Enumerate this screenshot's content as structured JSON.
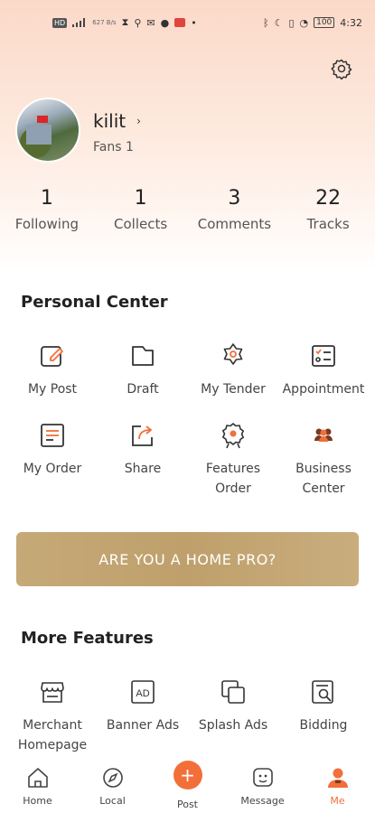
{
  "status_bar": {
    "net_speed": "627 B/s",
    "time": "4:32",
    "battery": "100"
  },
  "profile": {
    "username": "kilit",
    "fans": "Fans 1"
  },
  "stats": [
    {
      "value": "1",
      "label": "Following"
    },
    {
      "value": "1",
      "label": "Collects"
    },
    {
      "value": "3",
      "label": "Comments"
    },
    {
      "value": "22",
      "label": "Tracks"
    }
  ],
  "personal_center": {
    "title": "Personal Center",
    "items": [
      {
        "label": "My Post",
        "icon": "edit-icon"
      },
      {
        "label": "Draft",
        "icon": "folder-icon"
      },
      {
        "label": "My Tender",
        "icon": "badge-star-icon"
      },
      {
        "label": "Appointment",
        "icon": "checklist-icon"
      },
      {
        "label": "My Order",
        "icon": "order-list-icon"
      },
      {
        "label": "Share",
        "icon": "share-icon"
      },
      {
        "label": "Features Order",
        "icon": "award-icon"
      },
      {
        "label": "Business Center",
        "icon": "team-icon"
      }
    ]
  },
  "home_pro_banner": "ARE YOU A HOME PRO?",
  "more_features": {
    "title": "More Features",
    "items": [
      {
        "label": "Merchant Homepage",
        "icon": "store-icon"
      },
      {
        "label": "Banner Ads",
        "icon": "ad-icon"
      },
      {
        "label": "Splash Ads",
        "icon": "splash-icon"
      },
      {
        "label": "Bidding",
        "icon": "search-doc-icon"
      }
    ]
  },
  "tab_bar": [
    {
      "label": "Home",
      "icon": "home-icon"
    },
    {
      "label": "Local",
      "icon": "compass-icon"
    },
    {
      "label": "Post",
      "icon": "plus-icon"
    },
    {
      "label": "Message",
      "icon": "chat-icon"
    },
    {
      "label": "Me",
      "icon": "person-icon",
      "active": true
    }
  ],
  "colors": {
    "accent": "#f26f3a",
    "gold_banner": "#c5a977"
  }
}
